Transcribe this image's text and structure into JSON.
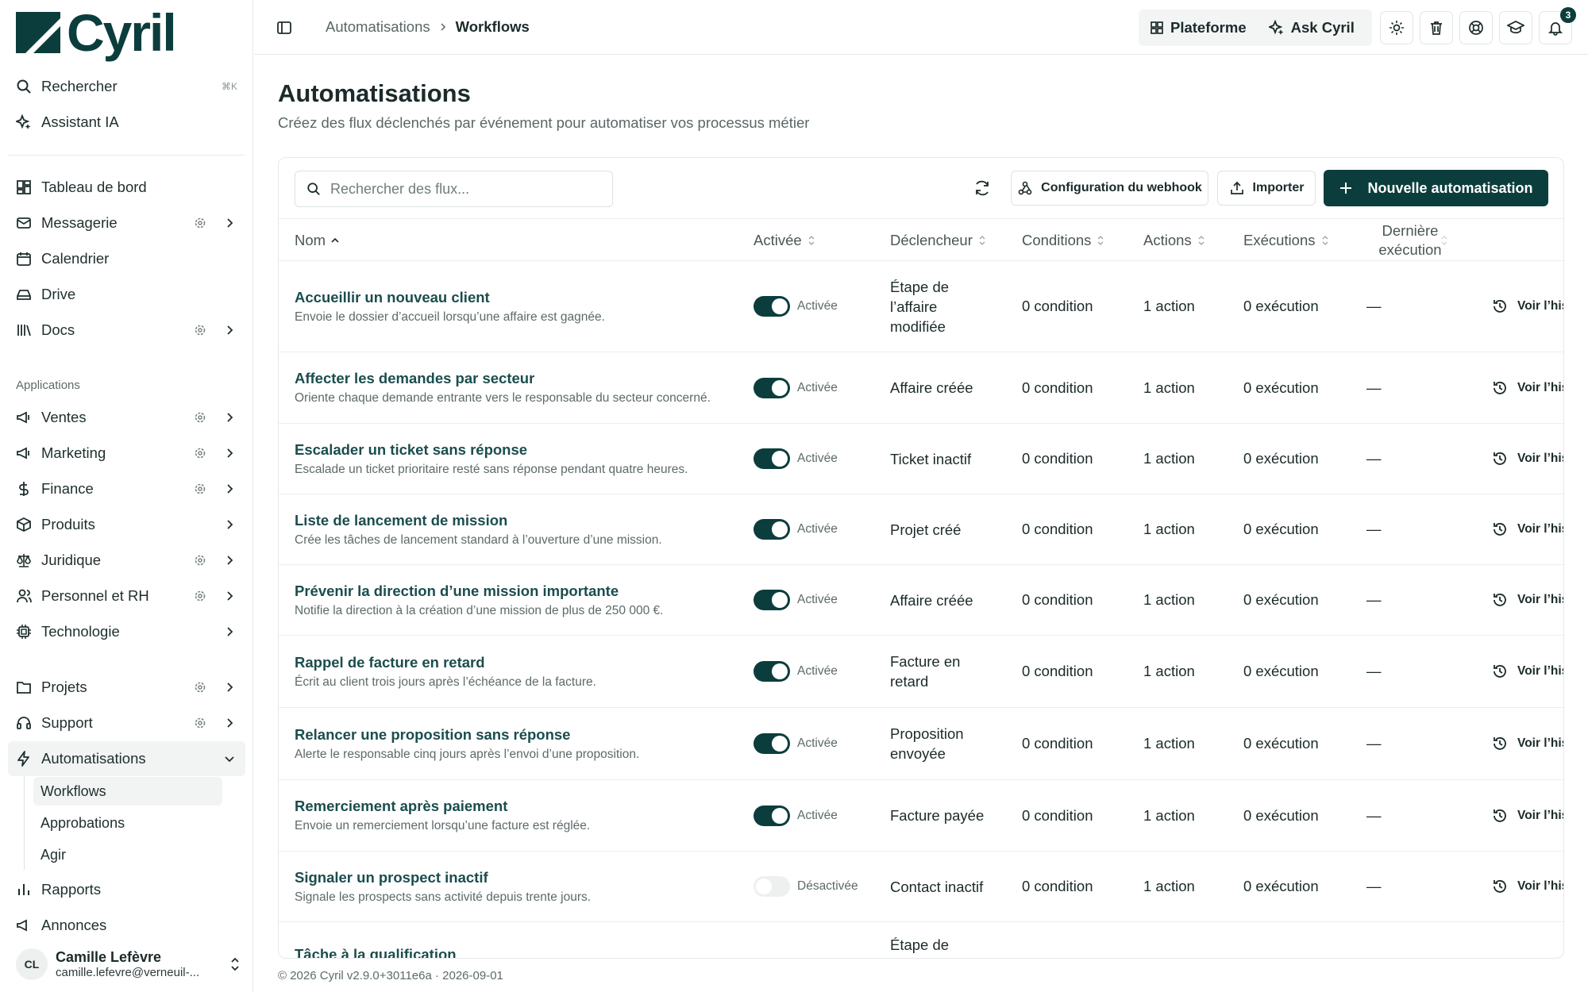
{
  "app": {
    "name": "Cyril"
  },
  "colors": {
    "brand": "#0c3d3d",
    "accent": "#1b4d4d"
  },
  "sidebar": {
    "search": {
      "label": "Rechercher",
      "shortcut": "⌘K"
    },
    "assistant": "Assistant IA",
    "main": [
      {
        "label": "Tableau de bord",
        "icon": "dashboard-icon"
      },
      {
        "label": "Messagerie",
        "icon": "mail-icon"
      },
      {
        "label": "Calendrier",
        "icon": "calendar-icon"
      },
      {
        "label": "Drive",
        "icon": "drive-icon"
      },
      {
        "label": "Docs",
        "icon": "library-icon"
      }
    ],
    "section_label": "Applications",
    "apps": [
      {
        "label": "Ventes",
        "icon": "megaphone-icon"
      },
      {
        "label": "Marketing",
        "icon": "megaphone-icon"
      },
      {
        "label": "Finance",
        "icon": "dollar-icon"
      },
      {
        "label": "Produits",
        "icon": "package-icon"
      },
      {
        "label": "Juridique",
        "icon": "scale-icon"
      },
      {
        "label": "Personnel et RH",
        "icon": "users-icon"
      },
      {
        "label": "Technologie",
        "icon": "cpu-icon"
      }
    ],
    "projects": [
      {
        "label": "Projets",
        "icon": "folder-icon"
      },
      {
        "label": "Support",
        "icon": "headset-icon"
      },
      {
        "label": "Automatisations",
        "icon": "zap-icon"
      }
    ],
    "sub_items": [
      "Workflows",
      "Approbations",
      "Agir"
    ],
    "more": [
      {
        "label": "Rapports",
        "icon": "chart-icon"
      },
      {
        "label": "Annonces",
        "icon": "megaphone-icon"
      }
    ],
    "user": {
      "initials": "CL",
      "name": "Camille Lefèvre",
      "email": "camille.lefevre@verneuil-..."
    }
  },
  "topbar": {
    "breadcrumb": [
      "Automatisations",
      "Workflows"
    ],
    "platform": "Plateforme",
    "ask": "Ask Cyril",
    "notifications": "3"
  },
  "page": {
    "title": "Automatisations",
    "subtitle": "Créez des flux déclenchés par événement pour automatiser vos processus métier"
  },
  "toolbar": {
    "search_placeholder": "Rechercher des flux...",
    "webhook": "Configuration du webhook",
    "import": "Importer",
    "new": "Nouvelle automatisation"
  },
  "table": {
    "headers": {
      "name": "Nom",
      "enabled": "Activée",
      "trigger": "Déclencheur",
      "conditions": "Conditions",
      "actions": "Actions",
      "executions": "Exécutions",
      "last": "Dernière exécution"
    },
    "rows": [
      {
        "name": "Accueillir un nouveau client",
        "desc": "Envoie le dossier d’accueil lorsqu’une affaire est gagnée.",
        "on": true,
        "status": "Activée",
        "trigger": "Étape de l’affaire modifiée",
        "conditions": "0 condition",
        "actions": "1 action",
        "executions": "0 exécution",
        "last": "—",
        "history": "Voir l’his"
      },
      {
        "name": "Affecter les demandes par secteur",
        "desc": "Oriente chaque demande entrante vers le responsable du secteur concerné.",
        "on": true,
        "status": "Activée",
        "trigger": "Affaire créée",
        "conditions": "0 condition",
        "actions": "1 action",
        "executions": "0 exécution",
        "last": "—",
        "history": "Voir l’his"
      },
      {
        "name": "Escalader un ticket sans réponse",
        "desc": "Escalade un ticket prioritaire resté sans réponse pendant quatre heures.",
        "on": true,
        "status": "Activée",
        "trigger": "Ticket inactif",
        "conditions": "0 condition",
        "actions": "1 action",
        "executions": "0 exécution",
        "last": "—",
        "history": "Voir l’his"
      },
      {
        "name": "Liste de lancement de mission",
        "desc": "Crée les tâches de lancement standard à l’ouverture d’une mission.",
        "on": true,
        "status": "Activée",
        "trigger": "Projet créé",
        "conditions": "0 condition",
        "actions": "1 action",
        "executions": "0 exécution",
        "last": "—",
        "history": "Voir l’his"
      },
      {
        "name": "Prévenir la direction d’une mission importante",
        "desc": "Notifie la direction à la création d’une mission de plus de 250 000 €.",
        "on": true,
        "status": "Activée",
        "trigger": "Affaire créée",
        "conditions": "0 condition",
        "actions": "1 action",
        "executions": "0 exécution",
        "last": "—",
        "history": "Voir l’his"
      },
      {
        "name": "Rappel de facture en retard",
        "desc": "Écrit au client trois jours après l’échéance de la facture.",
        "on": true,
        "status": "Activée",
        "trigger": "Facture en retard",
        "conditions": "0 condition",
        "actions": "1 action",
        "executions": "0 exécution",
        "last": "—",
        "history": "Voir l’his"
      },
      {
        "name": "Relancer une proposition sans réponse",
        "desc": "Alerte le responsable cinq jours après l’envoi d’une proposition.",
        "on": true,
        "status": "Activée",
        "trigger": "Proposition envoyée",
        "conditions": "0 condition",
        "actions": "1 action",
        "executions": "0 exécution",
        "last": "—",
        "history": "Voir l’his"
      },
      {
        "name": "Remerciement après paiement",
        "desc": "Envoie un remerciement lorsqu’une facture est réglée.",
        "on": true,
        "status": "Activée",
        "trigger": "Facture payée",
        "conditions": "0 condition",
        "actions": "1 action",
        "executions": "0 exécution",
        "last": "—",
        "history": "Voir l’his"
      },
      {
        "name": "Signaler un prospect inactif",
        "desc": "Signale les prospects sans activité depuis trente jours.",
        "on": false,
        "status": "Désactivée",
        "trigger": "Contact inactif",
        "conditions": "0 condition",
        "actions": "1 action",
        "executions": "0 exécution",
        "last": "—",
        "history": "Voir l’his"
      },
      {
        "name": "Tâche à la qualification",
        "desc": "",
        "on": true,
        "status": "",
        "trigger": "Étape de",
        "conditions": "",
        "actions": "",
        "executions": "",
        "last": "",
        "history": ""
      }
    ]
  },
  "footer": "© 2026 Cyril v2.9.0+3011e6a · 2026-09-01"
}
